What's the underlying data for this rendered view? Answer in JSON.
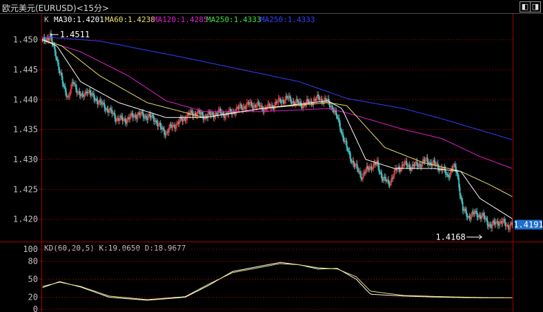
{
  "window": {
    "title": "欧元美元(EURUSD)<15分>",
    "nav_prev_icon": "◧",
    "nav_next_icon": "◨",
    "nav_settings_icon": "▣"
  },
  "colors": {
    "background": "#000000",
    "up_candle": "#ff3b3b",
    "down_candle": "#48c8c8",
    "grid": "#7a0000",
    "axis": "#a00000",
    "ma30": "#ffffff",
    "ma60": "#e8e070",
    "ma120": "#e020d0",
    "ma250_a": "#40e040",
    "ma250_b": "#3040ff",
    "last_price_bg": "#1e6fd0"
  },
  "main_legend": {
    "k_label": "K",
    "ma30": "MA30:1.4201",
    "ma60": "MA60:1.4238",
    "ma120": "MA120:1.4285",
    "ma250": "MA250:1.4333",
    "ma250b": "MA250:1.4333"
  },
  "kd_legend": {
    "name": "KD(60,20,5)",
    "k": "K:19.0650",
    "d": "D:18.9677"
  },
  "chart_data": [
    {
      "type": "candlestick",
      "title": "欧元美元(EURUSD)<15分>",
      "yticks": [
        "1.450",
        "1.445",
        "1.440",
        "1.435",
        "1.430",
        "1.425",
        "1.420"
      ],
      "ylim": [
        1.4165,
        1.4525
      ],
      "grid": true,
      "high_label": "1.4511",
      "low_label": "1.4168",
      "last_price": "1.4191",
      "close_anchors": [
        [
          0,
          1.4495
        ],
        [
          4,
          1.4502
        ],
        [
          8,
          1.4508
        ],
        [
          11,
          1.4488
        ],
        [
          14,
          1.4475
        ],
        [
          18,
          1.4448
        ],
        [
          22,
          1.442
        ],
        [
          27,
          1.4405
        ],
        [
          32,
          1.4428
        ],
        [
          37,
          1.4415
        ],
        [
          42,
          1.4402
        ],
        [
          47,
          1.4418
        ],
        [
          52,
          1.4405
        ],
        [
          57,
          1.44
        ],
        [
          62,
          1.4392
        ],
        [
          70,
          1.4382
        ],
        [
          77,
          1.437
        ],
        [
          85,
          1.4365
        ],
        [
          92,
          1.437
        ],
        [
          100,
          1.4375
        ],
        [
          110,
          1.4372
        ],
        [
          118,
          1.4368
        ],
        [
          124,
          1.4352
        ],
        [
          130,
          1.4345
        ],
        [
          136,
          1.4355
        ],
        [
          142,
          1.436
        ],
        [
          148,
          1.4368
        ],
        [
          154,
          1.4375
        ],
        [
          162,
          1.4378
        ],
        [
          170,
          1.4372
        ],
        [
          178,
          1.4375
        ],
        [
          186,
          1.4378
        ],
        [
          194,
          1.4375
        ],
        [
          202,
          1.4382
        ],
        [
          210,
          1.4388
        ],
        [
          218,
          1.4392
        ],
        [
          226,
          1.439
        ],
        [
          234,
          1.4385
        ],
        [
          242,
          1.439
        ],
        [
          250,
          1.4398
        ],
        [
          258,
          1.4402
        ],
        [
          266,
          1.4395
        ],
        [
          274,
          1.4392
        ],
        [
          282,
          1.4396
        ],
        [
          290,
          1.4402
        ],
        [
          298,
          1.4398
        ],
        [
          305,
          1.4388
        ],
        [
          312,
          1.436
        ],
        [
          320,
          1.4318
        ],
        [
          328,
          1.429
        ],
        [
          336,
          1.4272
        ],
        [
          344,
          1.4288
        ],
        [
          352,
          1.4292
        ],
        [
          358,
          1.4268
        ],
        [
          364,
          1.426
        ],
        [
          372,
          1.4282
        ],
        [
          380,
          1.4292
        ],
        [
          388,
          1.4288
        ],
        [
          396,
          1.4292
        ],
        [
          404,
          1.4298
        ],
        [
          412,
          1.4292
        ],
        [
          420,
          1.4285
        ],
        [
          426,
          1.4272
        ],
        [
          432,
          1.4288
        ],
        [
          436,
          1.4278
        ],
        [
          442,
          1.4215
        ],
        [
          448,
          1.4205
        ],
        [
          456,
          1.421
        ],
        [
          464,
          1.4203
        ],
        [
          472,
          1.4188
        ],
        [
          478,
          1.4196
        ],
        [
          484,
          1.4194
        ],
        [
          490,
          1.4189
        ],
        [
          494,
          1.4191
        ]
      ],
      "ma250_anchors": [
        [
          0,
          1.4505
        ],
        [
          60,
          1.4498
        ],
        [
          150,
          1.447
        ],
        [
          270,
          1.443
        ],
        [
          320,
          1.4402
        ],
        [
          380,
          1.4385
        ],
        [
          420,
          1.4368
        ],
        [
          494,
          1.4333
        ]
      ],
      "ma120_anchors": [
        [
          0,
          1.45
        ],
        [
          40,
          1.448
        ],
        [
          90,
          1.444
        ],
        [
          130,
          1.4398
        ],
        [
          170,
          1.438
        ],
        [
          230,
          1.438
        ],
        [
          300,
          1.4385
        ],
        [
          320,
          1.4378
        ],
        [
          380,
          1.435
        ],
        [
          420,
          1.4335
        ],
        [
          460,
          1.4305
        ],
        [
          494,
          1.4285
        ]
      ],
      "ma60_anchors": [
        [
          0,
          1.45
        ],
        [
          20,
          1.449
        ],
        [
          60,
          1.444
        ],
        [
          110,
          1.4395
        ],
        [
          170,
          1.437
        ],
        [
          230,
          1.4385
        ],
        [
          300,
          1.4395
        ],
        [
          320,
          1.439
        ],
        [
          360,
          1.432
        ],
        [
          400,
          1.4295
        ],
        [
          440,
          1.428
        ],
        [
          470,
          1.4258
        ],
        [
          494,
          1.4238
        ]
      ],
      "ma30_anchors": [
        [
          0,
          1.45
        ],
        [
          15,
          1.449
        ],
        [
          40,
          1.443
        ],
        [
          80,
          1.4395
        ],
        [
          130,
          1.437
        ],
        [
          170,
          1.437
        ],
        [
          230,
          1.4385
        ],
        [
          300,
          1.4398
        ],
        [
          315,
          1.4385
        ],
        [
          340,
          1.43
        ],
        [
          370,
          1.4285
        ],
        [
          410,
          1.4285
        ],
        [
          440,
          1.428
        ],
        [
          460,
          1.4235
        ],
        [
          494,
          1.4201
        ]
      ]
    },
    {
      "type": "line",
      "title": "KD(60,20,5)",
      "yticks": [
        "100",
        "80",
        "50",
        "20",
        "0"
      ],
      "ylim": [
        0,
        100
      ],
      "series": [
        {
          "name": "K",
          "anchors": [
            [
              0,
              36
            ],
            [
              18,
              46
            ],
            [
              40,
              37
            ],
            [
              70,
              20
            ],
            [
              110,
              15
            ],
            [
              150,
              20
            ],
            [
              175,
              40
            ],
            [
              200,
              63
            ],
            [
              230,
              72
            ],
            [
              250,
              78
            ],
            [
              270,
              74
            ],
            [
              290,
              67
            ],
            [
              310,
              68
            ],
            [
              330,
              50
            ],
            [
              345,
              25
            ],
            [
              380,
              22
            ],
            [
              420,
              20
            ],
            [
              460,
              19
            ],
            [
              494,
              19
            ]
          ]
        },
        {
          "name": "D",
          "anchors": [
            [
              0,
              38
            ],
            [
              18,
              45
            ],
            [
              40,
              38
            ],
            [
              70,
              22
            ],
            [
              110,
              16
            ],
            [
              150,
              21
            ],
            [
              175,
              42
            ],
            [
              200,
              61
            ],
            [
              230,
              70
            ],
            [
              250,
              76
            ],
            [
              270,
              74
            ],
            [
              290,
              69
            ],
            [
              310,
              67
            ],
            [
              330,
              54
            ],
            [
              345,
              30
            ],
            [
              380,
              23
            ],
            [
              420,
              21
            ],
            [
              460,
              19.5
            ],
            [
              494,
              19
            ]
          ]
        }
      ]
    }
  ]
}
